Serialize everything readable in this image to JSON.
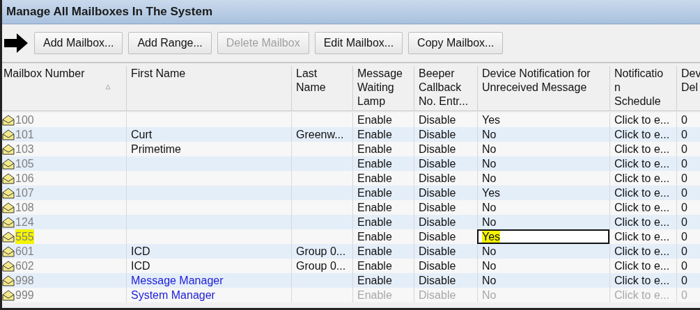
{
  "window": {
    "title": "Manage All Mailboxes In The System"
  },
  "buttons": [
    {
      "label": "Add Mailbox...",
      "disabled": false
    },
    {
      "label": "Add Range...",
      "disabled": false
    },
    {
      "label": "Delete Mailbox",
      "disabled": true
    },
    {
      "label": "Edit Mailbox...",
      "disabled": false
    },
    {
      "label": "Copy Mailbox...",
      "disabled": false
    }
  ],
  "table": {
    "columns": [
      {
        "label": "Mailbox Number",
        "sorted": true
      },
      {
        "label": "First Name",
        "sorted": false
      },
      {
        "label": "Last\nName",
        "sorted": false
      },
      {
        "label": "Message\nWaiting\nLamp",
        "sorted": false
      },
      {
        "label": "Beeper\nCallback\nNo. Entr...",
        "sorted": false
      },
      {
        "label": "Device Notification for\nUnreceived Message",
        "sorted": false
      },
      {
        "label": "Notificatio\nn\nSchedule",
        "sorted": false
      },
      {
        "label": "Dev\nDel",
        "sorted": false
      }
    ],
    "rows": [
      {
        "cells": [
          "100",
          "",
          "",
          "Enable",
          "Disable",
          "Yes",
          "Click to e...",
          "0"
        ],
        "disabled": false,
        "highlighted": false,
        "focused": false
      },
      {
        "cells": [
          "101",
          "Curt",
          "Greenw...",
          "Enable",
          "Disable",
          "No",
          "Click to e...",
          "0"
        ],
        "link": false,
        "disabled": false,
        "highlighted": false,
        "focused": false
      },
      {
        "cells": [
          "103",
          "Primetime",
          "",
          "Enable",
          "Disable",
          "No",
          "Click to e...",
          "0"
        ],
        "link": false,
        "disabled": false,
        "highlighted": false,
        "focused": false
      },
      {
        "cells": [
          "105",
          "",
          "",
          "Enable",
          "Disable",
          "No",
          "Click to e...",
          "0"
        ],
        "disabled": false,
        "highlighted": false,
        "focused": false
      },
      {
        "cells": [
          "106",
          "",
          "",
          "Enable",
          "Disable",
          "No",
          "Click to e...",
          "0"
        ],
        "disabled": false,
        "highlighted": false,
        "focused": false
      },
      {
        "cells": [
          "107",
          "",
          "",
          "Enable",
          "Disable",
          "Yes",
          "Click to e...",
          "0"
        ],
        "disabled": false,
        "highlighted": false,
        "focused": false
      },
      {
        "cells": [
          "108",
          "",
          "",
          "Enable",
          "Disable",
          "No",
          "Click to e...",
          "0"
        ],
        "disabled": false,
        "highlighted": false,
        "focused": false
      },
      {
        "cells": [
          "124",
          "",
          "",
          "Enable",
          "Disable",
          "No",
          "Click to e...",
          "0"
        ],
        "disabled": false,
        "highlighted": false,
        "focused": false
      },
      {
        "cells": [
          "555",
          "",
          "",
          "Enable",
          "Disable",
          "Yes",
          "Click to e...",
          "0"
        ],
        "disabled": false,
        "highlighted": true,
        "focused": true
      },
      {
        "cells": [
          "601",
          "ICD",
          "Group 0...",
          "Enable",
          "Disable",
          "No",
          "Click to e...",
          "0"
        ],
        "link": false,
        "disabled": false,
        "highlighted": false,
        "focused": false
      },
      {
        "cells": [
          "602",
          "ICD",
          "Group 0...",
          "Enable",
          "Disable",
          "No",
          "Click to e...",
          "0"
        ],
        "link": false,
        "disabled": false,
        "highlighted": false,
        "focused": false
      },
      {
        "cells": [
          "998",
          "Message Manager",
          "",
          "Enable",
          "Disable",
          "No",
          "Click to e...",
          "0"
        ],
        "link": true,
        "disabled": false,
        "highlighted": false,
        "focused": false
      },
      {
        "cells": [
          "999",
          "System Manager",
          "",
          "Enable",
          "Disable",
          "No",
          "Click to e...",
          "0"
        ],
        "link": true,
        "disabled": true,
        "highlighted": false,
        "focused": false
      }
    ]
  }
}
